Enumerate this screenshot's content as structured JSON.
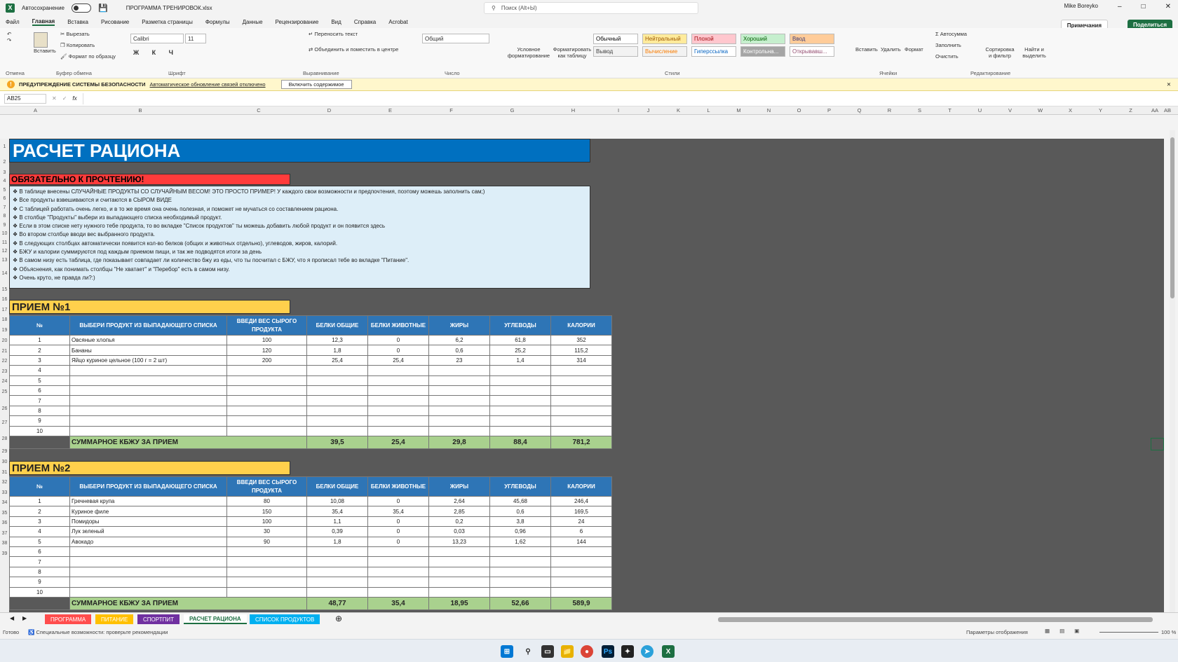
{
  "titlebar": {
    "autosave": "Автосохранение",
    "filename": "ПРОГРАММА ТРЕНИРОВОК.xlsx",
    "search_placeholder": "Поиск (Alt+Ы)",
    "user": "Mike Boreyko"
  },
  "menu": [
    "Файл",
    "Главная",
    "Вставка",
    "Рисование",
    "Разметка страницы",
    "Формулы",
    "Данные",
    "Рецензирование",
    "Вид",
    "Справка",
    "Acrobat"
  ],
  "menu_selected": "Главная",
  "notes_btn": "Примечания",
  "share_btn": "Поделиться",
  "ribbon": {
    "undo_label": "Отмена",
    "paste": "Вставить",
    "cut": "Вырезать",
    "copy": "Копировать",
    "format_painter": "Формат по образцу",
    "clipboard": "Буфер обмена",
    "font_name": "Calibri",
    "font_size": "11",
    "font_group": "Шрифт",
    "wrap": "Переносить текст",
    "merge": "Объединить и поместить в центре",
    "align_group": "Выравнивание",
    "number_format": "Общий",
    "number_group": "Число",
    "cond_format": "Условное форматирование",
    "format_table": "Форматировать как таблицу",
    "styles": [
      {
        "label": "Обычный",
        "bg": "#ffffff",
        "fg": "#000000"
      },
      {
        "label": "Нейтральный",
        "bg": "#ffeb9c",
        "fg": "#9c5700"
      },
      {
        "label": "Плохой",
        "bg": "#ffc7ce",
        "fg": "#9c0006"
      },
      {
        "label": "Хороший",
        "bg": "#c6efce",
        "fg": "#006100"
      },
      {
        "label": "Ввод",
        "bg": "#ffcc99",
        "fg": "#3f3f76"
      },
      {
        "label": "Вывод",
        "bg": "#f2f2f2",
        "fg": "#3f3f3f"
      },
      {
        "label": "Вычисление",
        "bg": "#f2f2f2",
        "fg": "#fa7d00"
      },
      {
        "label": "Гиперссылка",
        "bg": "#ffffff",
        "fg": "#0563c1"
      },
      {
        "label": "Контрольна...",
        "bg": "#a5a5a5",
        "fg": "#ffffff"
      },
      {
        "label": "Открывавш...",
        "bg": "#ffffff",
        "fg": "#954f72"
      }
    ],
    "styles_group": "Стили",
    "insert": "Вставить",
    "delete": "Удалить",
    "format": "Формат",
    "cells_group": "Ячейки",
    "autosum": "Автосумма",
    "fill": "Заполнить",
    "clear": "Очистить",
    "sort": "Сортировка и фильтр",
    "find": "Найти и выделить",
    "edit_group": "Редактирование"
  },
  "security": {
    "title": "ПРЕДУПРЕЖДЕНИЕ СИСТЕМЫ БЕЗОПАСНОСТИ",
    "msg": "Автоматическое обновление связей отключено",
    "btn": "Включить содержимое"
  },
  "formula": {
    "namebox": "AB25",
    "fx": "fx",
    "value": ""
  },
  "columns": [
    "A",
    "B",
    "C",
    "D",
    "E",
    "F",
    "G",
    "H",
    "I",
    "J",
    "K",
    "L",
    "M",
    "N",
    "O",
    "P",
    "Q",
    "R",
    "S",
    "T",
    "U",
    "V",
    "W",
    "X",
    "Y",
    "Z",
    "AA",
    "AB"
  ],
  "sheet": {
    "title": "РАСЧЕТ РАЦИОНА",
    "must_read": "ОБЯЗАТЕЛЬНО К ПРОЧТЕНИЮ!",
    "notes": [
      "В таблице внесены СЛУЧАЙНЫЕ ПРОДУКТЫ СО СЛУЧАЙНЫМ ВЕСОМ! ЭТО ПРОСТО ПРИМЕР! У каждого свои возможности и предпочтения, поэтому можешь заполнить сам;)",
      "Все продукты взвешиваются и считаются в СЫРОМ ВИДЕ",
      "С таблицей работать очень легко, и в то же время она очень полезная, и поможет не мучаться со составлением рациона.",
      "В столбце \"Продукты\" выбери из выпадающего списка необходимый продукт.",
      "Если в этом списке нету нужного тебе продукта, то во вкладке \"Список продуктов\" ты можешь добавить любой продукт и он появится здесь",
      "Во втором столбце вводи вес выбранного продукта.",
      "В следующих столбцах автоматически появится кол-во белков (общих и животных отдельно), углеводов, жиров, калорий.",
      "БЖУ и калории суммируются под каждым приемом пищи, и так же подводятся итоги за день",
      "В самом низу есть таблица, где показывает совпадает ли количество бжу из еды, что ты посчитал с БЖУ, что я прописал тебе во вкладке \"Питание\".",
      "Объяснения, как понимать столбцы \"Не хватает\" и \"Перебор\" есть в самом низу.",
      "Очень круто, не правда ли?:)"
    ],
    "headers": [
      "№",
      "ВЫБЕРИ ПРОДУКТ ИЗ ВЫПАДАЮЩЕГО СПИСКА",
      "ВВЕДИ ВЕС СЫРОГО ПРОДУКТА",
      "БЕЛКИ ОБЩИЕ",
      "БЕЛКИ ЖИВОТНЫЕ",
      "ЖИРЫ",
      "УГЛЕВОДЫ",
      "КАЛОРИИ"
    ],
    "sum_label": "СУММАРНОЕ КБЖУ ЗА ПРИЕМ",
    "meals": [
      {
        "title": "ПРИЕМ №1",
        "rows": [
          [
            "1",
            "Овсяные хлопья",
            "100",
            "12,3",
            "0",
            "6,2",
            "61,8",
            "352"
          ],
          [
            "2",
            "Бананы",
            "120",
            "1,8",
            "0",
            "0,6",
            "25,2",
            "115,2"
          ],
          [
            "3",
            "Яйцо куриное цельное (100 г = 2 шт)",
            "200",
            "25,4",
            "25,4",
            "23",
            "1,4",
            "314"
          ],
          [
            "4",
            "",
            "",
            "",
            "",
            "",
            "",
            ""
          ],
          [
            "5",
            "",
            "",
            "",
            "",
            "",
            "",
            ""
          ],
          [
            "6",
            "",
            "",
            "",
            "",
            "",
            "",
            ""
          ],
          [
            "7",
            "",
            "",
            "",
            "",
            "",
            "",
            ""
          ],
          [
            "8",
            "",
            "",
            "",
            "",
            "",
            "",
            ""
          ],
          [
            "9",
            "",
            "",
            "",
            "",
            "",
            "",
            ""
          ],
          [
            "10",
            "",
            "",
            "",
            "",
            "",
            "",
            ""
          ]
        ],
        "sum": [
          "39,5",
          "25,4",
          "29,8",
          "88,4",
          "781,2"
        ]
      },
      {
        "title": "ПРИЕМ №2",
        "rows": [
          [
            "1",
            "Гречневая крупа",
            "80",
            "10,08",
            "0",
            "2,64",
            "45,68",
            "246,4"
          ],
          [
            "2",
            "Куриное филе",
            "150",
            "35,4",
            "35,4",
            "2,85",
            "0,6",
            "169,5"
          ],
          [
            "3",
            "Помидоры",
            "100",
            "1,1",
            "0",
            "0,2",
            "3,8",
            "24"
          ],
          [
            "4",
            "Лук зеленый",
            "30",
            "0,39",
            "0",
            "0,03",
            "0,96",
            "6"
          ],
          [
            "5",
            "Авокадо",
            "90",
            "1,8",
            "0",
            "13,23",
            "1,62",
            "144"
          ],
          [
            "6",
            "",
            "",
            "",
            "",
            "",
            "",
            ""
          ],
          [
            "7",
            "",
            "",
            "",
            "",
            "",
            "",
            ""
          ],
          [
            "8",
            "",
            "",
            "",
            "",
            "",
            "",
            ""
          ],
          [
            "9",
            "",
            "",
            "",
            "",
            "",
            "",
            ""
          ],
          [
            "10",
            "",
            "",
            "",
            "",
            "",
            "",
            ""
          ]
        ],
        "sum": [
          "48,77",
          "35,4",
          "18,95",
          "52,66",
          "589,9"
        ]
      }
    ]
  },
  "tabs": [
    {
      "label": "ПРОГРАММА",
      "color": "#ff4d4d"
    },
    {
      "label": "ПИТАНИЕ",
      "color": "#ffc000"
    },
    {
      "label": "СПОРТПИТ",
      "color": "#7030a0"
    },
    {
      "label": "РАСЧЕТ РАЦИОНА",
      "color": "#ffffff"
    },
    {
      "label": "СПИСОК ПРОДУКТОВ",
      "color": "#00b0f0"
    }
  ],
  "status": {
    "ready": "Готово",
    "accessibility": "Специальные возможности: проверьте рекомендации",
    "display": "Параметры отображения",
    "zoom": "100 %"
  }
}
